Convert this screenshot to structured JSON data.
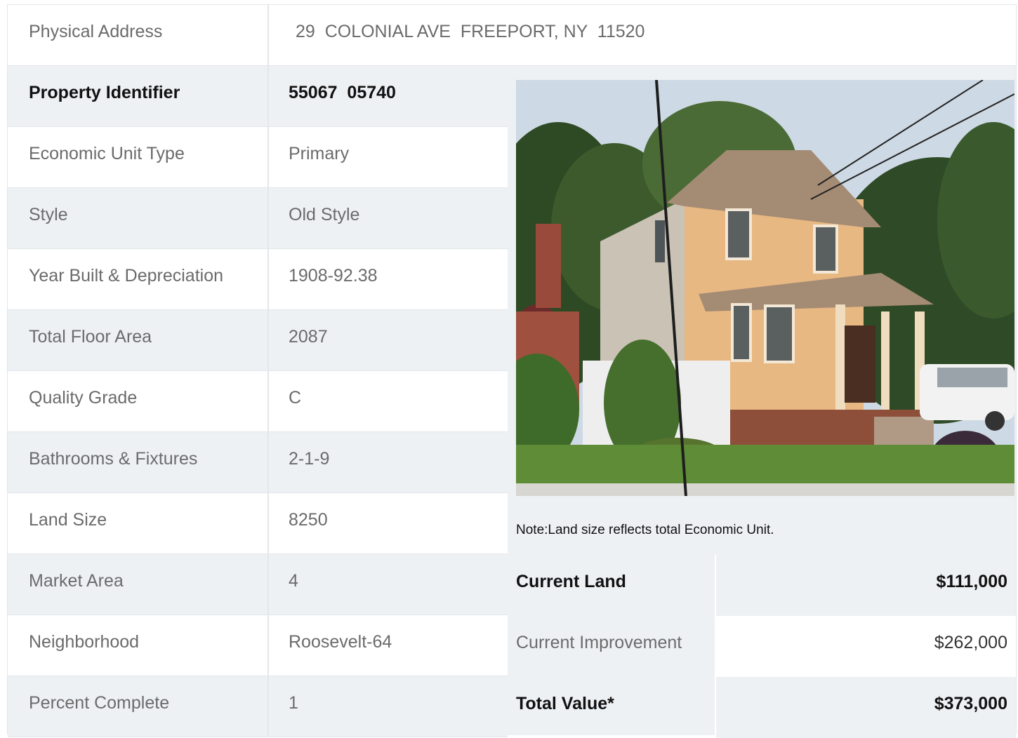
{
  "address": {
    "label": "Physical Address",
    "value": "29  COLONIAL AVE  FREEPORT, NY  11520"
  },
  "details": [
    {
      "label": "Property Identifier",
      "value": "55067  05740",
      "strong": true
    },
    {
      "label": "Economic Unit Type",
      "value": "Primary"
    },
    {
      "label": "Style",
      "value": "Old Style"
    },
    {
      "label": "Year Built & Depreciation",
      "value": "1908-92.38"
    },
    {
      "label": "Total Floor Area",
      "value": "2087"
    },
    {
      "label": "Quality Grade",
      "value": "C"
    },
    {
      "label": "Bathrooms & Fixtures",
      "value": "2-1-9"
    },
    {
      "label": "Land Size",
      "value": "8250"
    },
    {
      "label": "Market Area",
      "value": "4"
    },
    {
      "label": "Neighborhood",
      "value": "Roosevelt-64"
    },
    {
      "label": "Percent Complete",
      "value": "1"
    }
  ],
  "note": "Note:Land size reflects total Economic Unit.",
  "values": [
    {
      "label": "Current Land",
      "amount": "$111,000",
      "strong": true
    },
    {
      "label": "Current Improvement",
      "amount": "$262,000"
    },
    {
      "label": "Total Value*",
      "amount": "$373,000",
      "strong": true
    }
  ]
}
